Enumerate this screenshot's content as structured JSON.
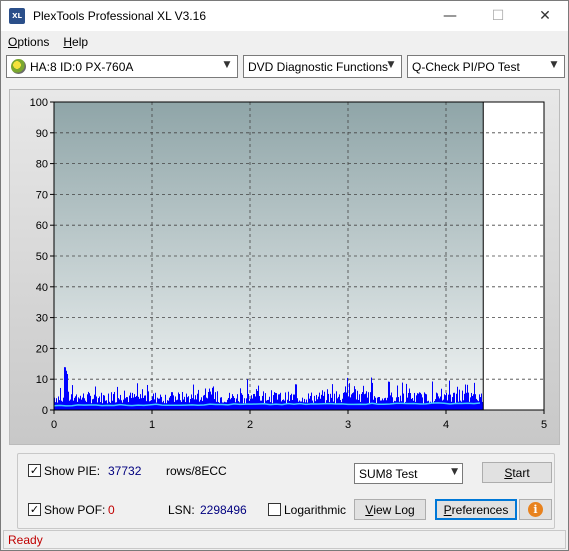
{
  "window": {
    "title": "PlexTools Professional XL V3.16",
    "icon_text": "XL",
    "minimize_glyph": "—",
    "maximize_glyph": "☐",
    "close_glyph": "✕"
  },
  "menu": {
    "options": {
      "accel": "O",
      "rest": "ptions"
    },
    "help": {
      "accel": "H",
      "rest": "elp"
    }
  },
  "toolbar": {
    "drive": "HA:8 ID:0  PX-760A",
    "function": "DVD Diagnostic Functions",
    "test": "Q-Check PI/PO Test"
  },
  "chart_data": {
    "type": "bar",
    "x_ticks": [
      "0",
      "1",
      "2",
      "3",
      "4",
      "5"
    ],
    "y_ticks": [
      "100",
      "90",
      "80",
      "70",
      "60",
      "50",
      "40",
      "30",
      "20",
      "10",
      "0"
    ],
    "xlim": [
      0,
      5
    ],
    "ylim": [
      0,
      100
    ],
    "data_end_x": 4.38,
    "grid": true,
    "colors": {
      "bars": "#0000ff",
      "average_line": "#40c8ff",
      "plot_bg_top": "#8fa5a8",
      "plot_bg_bottom": "#f2f5f5"
    },
    "series": [
      {
        "kind": "pie_bars",
        "typical_y": 6,
        "peak_y": 14,
        "peak_x": 0.12
      },
      {
        "kind": "average",
        "y_start": 1.5,
        "y_end": 2.2
      }
    ]
  },
  "controls": {
    "show_pie_label": "Show PIE:",
    "pie_value": "37732",
    "rows_label": "rows/8ECC",
    "show_pof_label": "Show POF:",
    "pof_value": "0",
    "lsn_label": "LSN:",
    "lsn_value": "2298496",
    "logarithmic_label": "Logarithmic",
    "sum_select": "SUM8 Test",
    "start": {
      "accel": "S",
      "rest": "tart"
    },
    "view_log": {
      "accel": "V",
      "rest": "iew Log"
    },
    "preferences": {
      "accel": "P",
      "rest": "references"
    },
    "check_glyph": "✓",
    "info_glyph": "i"
  },
  "status": {
    "text": "Ready"
  }
}
